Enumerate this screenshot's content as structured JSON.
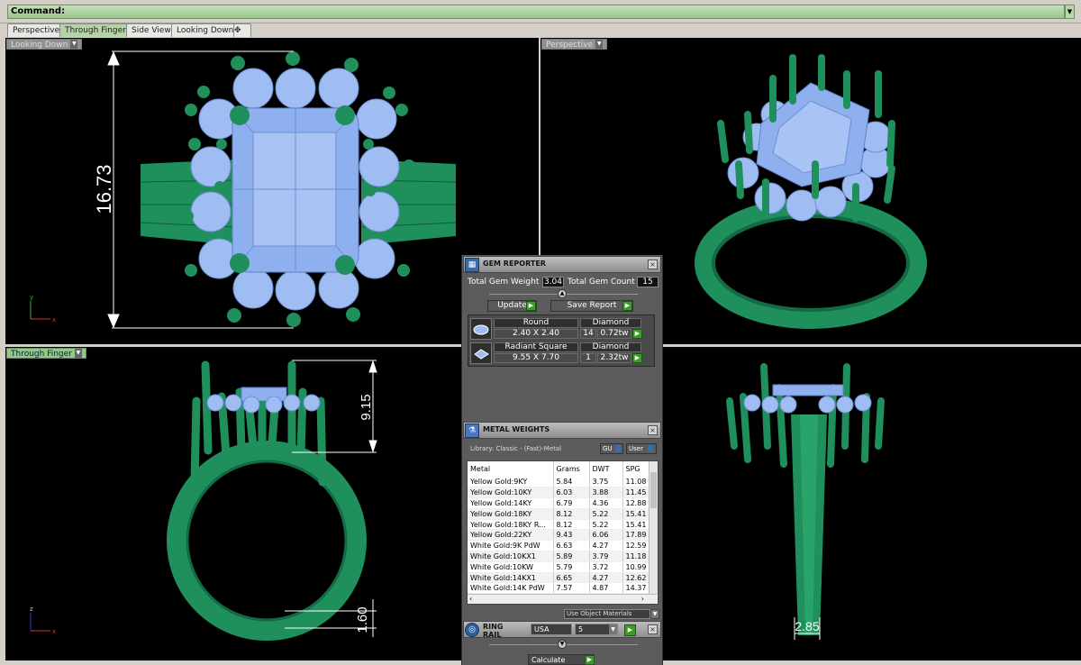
{
  "command": {
    "label": "Command:"
  },
  "tabs": [
    "Perspective",
    "Through Finger",
    "Side View",
    "Looking Down"
  ],
  "tab_add": "✥",
  "viewports": {
    "top_left": {
      "title": "Looking Down",
      "dimension": "16.73",
      "axis_v": "y",
      "axis_h": "x"
    },
    "top_right": {
      "title": "Perspective"
    },
    "bottom_left": {
      "title": "Through Finger",
      "dimension_top": "9.15",
      "dimension_bottom": "1.60",
      "axis_v": "z",
      "axis_h": "x"
    },
    "bottom_right": {
      "dimension": "2.85"
    }
  },
  "gem_reporter": {
    "title": "GEM REPORTER",
    "total_weight_label": "Total Gem Weight",
    "total_weight": "3.04",
    "total_count_label": "Total Gem Count",
    "total_count": "15",
    "update_label": "Update",
    "save_label": "Save Report",
    "gems": [
      {
        "shape": "Round",
        "material": "Diamond",
        "size": "2.40 X 2.40",
        "count": "14",
        "weight": "0.72tw"
      },
      {
        "shape": "Radiant Square",
        "material": "Diamond",
        "size": "9.55 X 7.70",
        "count": "1",
        "weight": "2.32tw"
      }
    ]
  },
  "metal_weights": {
    "title": "METAL WEIGHTS",
    "library": "Library: Classic - (Fast)-Metal",
    "gu_label": "GU",
    "user_label": "User",
    "columns": [
      "Metal",
      "Grams",
      "DWT",
      "SPG"
    ],
    "rows": [
      [
        "Yellow Gold:9KY",
        "5.84",
        "3.75",
        "11.08"
      ],
      [
        "Yellow Gold:10KY",
        "6.03",
        "3.88",
        "11.45"
      ],
      [
        "Yellow Gold:14KY",
        "6.79",
        "4.36",
        "12.88"
      ],
      [
        "Yellow Gold:18KY",
        "8.12",
        "5.22",
        "15.41"
      ],
      [
        "Yellow Gold:18KY R...",
        "8.12",
        "5.22",
        "15.41"
      ],
      [
        "Yellow Gold:22KY",
        "9.43",
        "6.06",
        "17.89"
      ],
      [
        "White Gold:9K PdW",
        "6.63",
        "4.27",
        "12.59"
      ],
      [
        "White Gold:10KX1",
        "5.89",
        "3.79",
        "11.18"
      ],
      [
        "White Gold:10KW",
        "5.79",
        "3.72",
        "10.99"
      ],
      [
        "White Gold:14KX1",
        "6.65",
        "4.27",
        "12.62"
      ],
      [
        "White Gold:14K PdW",
        "7.57",
        "4.87",
        "14.37"
      ]
    ],
    "use_object_materials": "Use Object Materials"
  },
  "ring_rail": {
    "title": "RING RAIL",
    "region": "USA",
    "size": "5",
    "calculate_label": "Calculate"
  },
  "colors": {
    "metal": "#1f8f5c",
    "gem": "#9fbdf2",
    "viewport_bg": "#000000",
    "active_tab": "#b5d3a6"
  }
}
